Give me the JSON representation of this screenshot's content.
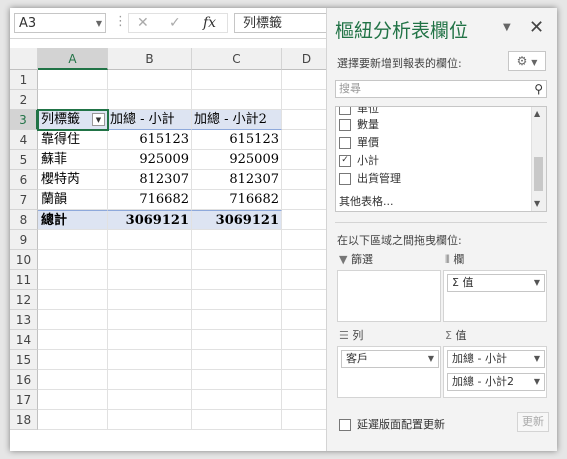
{
  "formula_bar": {
    "name_box": "A3",
    "content": "列標籤",
    "cancel_icon": "✕",
    "enter_icon": "✓",
    "fx_icon": "fx"
  },
  "sheet": {
    "columns": [
      "A",
      "B",
      "C",
      "D"
    ],
    "rows": [
      "1",
      "2",
      "3",
      "4",
      "5",
      "6",
      "7",
      "8",
      "9",
      "10",
      "11",
      "12",
      "13",
      "14",
      "15",
      "16",
      "17",
      "18"
    ],
    "pivot": {
      "header": [
        "列標籤",
        "加總 - 小計",
        "加總 - 小計2"
      ],
      "data": [
        [
          "靠得住",
          "615123",
          "615123"
        ],
        [
          "蘇菲",
          "925009",
          "925009"
        ],
        [
          "櫻特芮",
          "812307",
          "812307"
        ],
        [
          "蘭韻",
          "716682",
          "716682"
        ]
      ],
      "total": [
        "總計",
        "3069121",
        "3069121"
      ]
    }
  },
  "pane": {
    "title": "樞紐分析表欄位",
    "choose_label": "選擇要新增到報表的欄位:",
    "search_placeholder": "搜尋",
    "fields": [
      {
        "label": "單位",
        "checked": false
      },
      {
        "label": "數量",
        "checked": false
      },
      {
        "label": "單價",
        "checked": false
      },
      {
        "label": "小計",
        "checked": true
      },
      {
        "label": "出貨管理",
        "checked": false
      }
    ],
    "more_tables": "其他表格...",
    "drag_label": "在以下區域之間拖曳欄位:",
    "zones": {
      "filters": {
        "label": "篩選",
        "icon": "filter-icon"
      },
      "columns": {
        "label": "欄",
        "items": [
          "Σ 值"
        ],
        "icon": "columns-icon"
      },
      "rows": {
        "label": "列",
        "items": [
          "客戶"
        ],
        "icon": "rows-icon"
      },
      "values": {
        "label": "值",
        "items": [
          "加總 - 小計",
          "加總 - 小計2"
        ],
        "icon": "sigma-icon"
      }
    },
    "defer_label": "延遲版面配置更新",
    "update_button": "更新"
  },
  "colors": {
    "accent": "#217346",
    "pivot_band": "#dde4f2"
  }
}
